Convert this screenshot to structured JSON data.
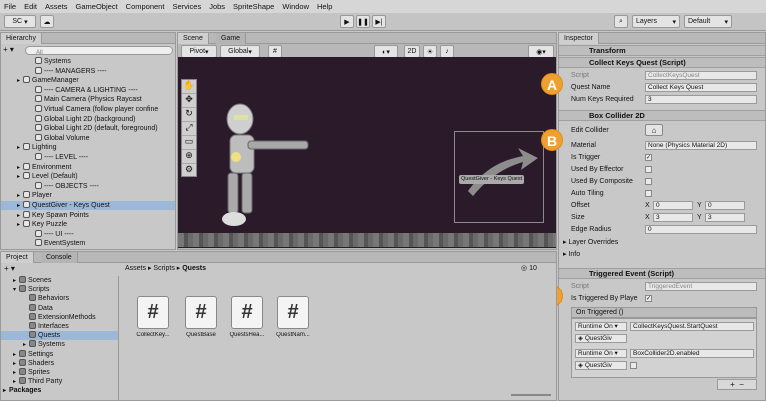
{
  "menu": [
    "File",
    "Edit",
    "Assets",
    "GameObject",
    "Component",
    "Services",
    "Jobs",
    "SpriteShape",
    "Window",
    "Help"
  ],
  "toolbar": {
    "account": "SC",
    "layers": "Layers",
    "layout": "Default"
  },
  "hierarchy": {
    "tab": "Hierarchy",
    "search_placeholder": "All",
    "items": [
      {
        "label": "Systems",
        "indent": 2,
        "arrow": ""
      },
      {
        "label": "---- MANAGERS ----",
        "indent": 2,
        "arrow": ""
      },
      {
        "label": "GameManager",
        "indent": 1,
        "arrow": "▸"
      },
      {
        "label": "---- CAMERA & LIGHTING ----",
        "indent": 2,
        "arrow": ""
      },
      {
        "label": "Main Camera (Physics Raycast",
        "indent": 2,
        "arrow": ""
      },
      {
        "label": "Virtual Camera (follow player confine",
        "indent": 2,
        "arrow": ""
      },
      {
        "label": "Global Light 2D (background)",
        "indent": 2,
        "arrow": ""
      },
      {
        "label": "Global Light 2D (default, foreground)",
        "indent": 2,
        "arrow": ""
      },
      {
        "label": "Global Volume",
        "indent": 2,
        "arrow": ""
      },
      {
        "label": "Lighting",
        "indent": 1,
        "arrow": "▸"
      },
      {
        "label": "---- LEVEL ----",
        "indent": 2,
        "arrow": ""
      },
      {
        "label": "Environment",
        "indent": 1,
        "arrow": "▸"
      },
      {
        "label": "Level (Default)",
        "indent": 1,
        "arrow": "▸"
      },
      {
        "label": "---- OBJECTS ----",
        "indent": 2,
        "arrow": ""
      },
      {
        "label": "Player",
        "indent": 1,
        "arrow": "▸"
      },
      {
        "label": "QuestGiver - Keys Quest",
        "indent": 1,
        "arrow": "▸",
        "selected": true
      },
      {
        "label": "Key Spawn Points",
        "indent": 1,
        "arrow": "▸"
      },
      {
        "label": "Key Puzzle",
        "indent": 1,
        "arrow": "▸"
      },
      {
        "label": "---- UI ----",
        "indent": 2,
        "arrow": ""
      },
      {
        "label": "EventSystem",
        "indent": 2,
        "arrow": ""
      }
    ]
  },
  "scene": {
    "tabs": [
      "Scene",
      "Game"
    ],
    "pivot": "Pivot",
    "global": "Global",
    "label_text": "QuestGiver - Keys Quest"
  },
  "project": {
    "tabs": [
      "Project",
      "Console"
    ],
    "tree": [
      {
        "label": "Scenes",
        "indent": 1,
        "arrow": "▸"
      },
      {
        "label": "Scripts",
        "indent": 1,
        "arrow": "▾"
      },
      {
        "label": "Behaviors",
        "indent": 2,
        "arrow": ""
      },
      {
        "label": "Data",
        "indent": 2,
        "arrow": ""
      },
      {
        "label": "ExtensionMethods",
        "indent": 2,
        "arrow": ""
      },
      {
        "label": "Interfaces",
        "indent": 2,
        "arrow": ""
      },
      {
        "label": "Quests",
        "indent": 2,
        "arrow": "",
        "selected": true
      },
      {
        "label": "Systems",
        "indent": 2,
        "arrow": "▸"
      },
      {
        "label": "Settings",
        "indent": 1,
        "arrow": "▸"
      },
      {
        "label": "Shaders",
        "indent": 1,
        "arrow": "▸"
      },
      {
        "label": "Sprites",
        "indent": 1,
        "arrow": "▸"
      },
      {
        "label": "Third Party",
        "indent": 1,
        "arrow": "▸"
      }
    ],
    "packages": "Packages",
    "breadcrumb": [
      "Assets",
      "Scripts",
      "Quests"
    ],
    "count": "10",
    "files": [
      "CollectKey...",
      "QuestBase",
      "QuestsHea...",
      "QuestNam..."
    ]
  },
  "inspector": {
    "tab": "Inspector",
    "transform": "Transform",
    "collect": {
      "title": "Collect Keys Quest (Script)",
      "script_label": "Script",
      "script_value": "CollectKeysQuest",
      "quest_name_label": "Quest Name",
      "quest_name_value": "Collect Keys Quest",
      "num_keys_label": "Num Keys Required",
      "num_keys_value": "3"
    },
    "box": {
      "title": "Box Collider 2D",
      "edit_collider": "Edit Collider",
      "material_label": "Material",
      "material_value": "None (Physics Material 2D)",
      "is_trigger": "Is Trigger",
      "used_effector": "Used By Effector",
      "used_composite": "Used By Composite",
      "auto_tiling": "Auto Tiling",
      "offset_label": "Offset",
      "offset_x": "0",
      "offset_y": "0",
      "size_label": "Size",
      "size_x": "3",
      "size_y": "3",
      "edge_label": "Edge Radius",
      "edge_value": "0",
      "layer_overrides": "Layer Overrides",
      "info": "Info",
      "x": "X",
      "y": "Y"
    },
    "triggered": {
      "title": "Triggered Event (Script)",
      "script_label": "Script",
      "script_value": "TriggeredEvent",
      "is_triggered_label": "Is Triggered By Playe",
      "on_triggered": "On Triggered ()",
      "runtime1": "Runtime On",
      "func1": "CollectKeysQuest.StartQuest",
      "obj1": "QuestGiv",
      "runtime2": "Runtime On",
      "func2": "BoxCollider2D.enabled",
      "obj2": "QuestGiv"
    },
    "badges": [
      "A",
      "B",
      "C"
    ]
  },
  "colors": {
    "badge": "#f0a030",
    "selection": "#9cb8d8",
    "scene_bg": "#2b1a2a"
  }
}
